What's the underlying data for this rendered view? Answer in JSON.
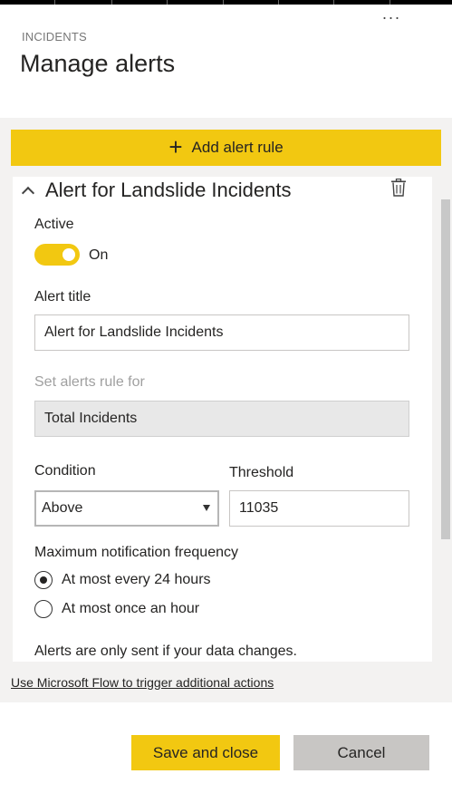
{
  "header": {
    "kicker": "INCIDENTS",
    "title": "Manage alerts",
    "more_icon": "more-horizontal-icon",
    "more_glyph": "···"
  },
  "add_rule": {
    "icon": "plus-icon",
    "plus_glyph": "+",
    "label": "Add alert rule"
  },
  "alert": {
    "title": "Alert for Landslide Incidents",
    "collapse_icon": "chevron-up-icon",
    "delete_icon": "trash-icon",
    "active_label": "Active",
    "toggle_state": "On",
    "alert_title_label": "Alert title",
    "alert_title_value": "Alert for Landslide Incidents",
    "set_rule_label": "Set alerts rule for",
    "set_rule_value": "Total Incidents",
    "condition_label": "Condition",
    "condition_value": "Above",
    "threshold_label": "Threshold",
    "threshold_value": "11035",
    "frequency_label": "Maximum notification frequency",
    "frequency_options": [
      {
        "label": "At most every 24 hours",
        "selected": true
      },
      {
        "label": "At most once an hour",
        "selected": false
      }
    ],
    "note": "Alerts are only sent if your data changes."
  },
  "flow_link": "Use Microsoft Flow to trigger additional actions",
  "footer": {
    "save_label": "Save and close",
    "cancel_label": "Cancel"
  },
  "colors": {
    "accent": "#f2c811",
    "panel_bg": "#f3f2f1",
    "text": "#252423",
    "muted": "#a0a0a0"
  }
}
